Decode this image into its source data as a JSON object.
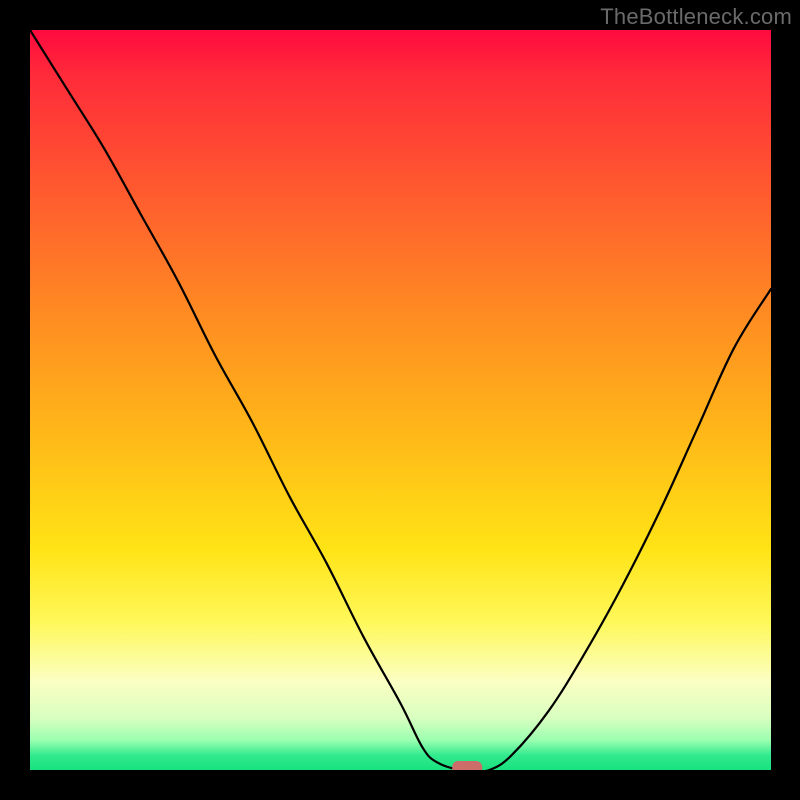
{
  "attribution": "TheBottleneck.com",
  "chart_data": {
    "type": "line",
    "title": "",
    "xlabel": "",
    "ylabel": "",
    "xlim": [
      0,
      100
    ],
    "ylim": [
      0,
      100
    ],
    "grid": false,
    "legend": false,
    "series": [
      {
        "name": "bottleneck-curve",
        "x": [
          0,
          5,
          10,
          15,
          20,
          25,
          30,
          35,
          40,
          45,
          50,
          53,
          55,
          58,
          60,
          62,
          65,
          70,
          75,
          80,
          85,
          90,
          95,
          100
        ],
        "y": [
          100,
          92,
          84,
          75,
          66,
          56,
          47,
          37,
          28,
          18,
          9,
          3,
          1,
          0,
          0,
          0,
          2,
          8,
          16,
          25,
          35,
          46,
          57,
          65
        ]
      }
    ],
    "marker": {
      "x": 59,
      "y": 0,
      "color": "#cc6d6a"
    },
    "background_gradient": {
      "top": "#ff0a3f",
      "upper_mid": "#ff8a22",
      "mid": "#ffe315",
      "lower_mid": "#fbffc2",
      "bottom": "#18e27f"
    }
  }
}
